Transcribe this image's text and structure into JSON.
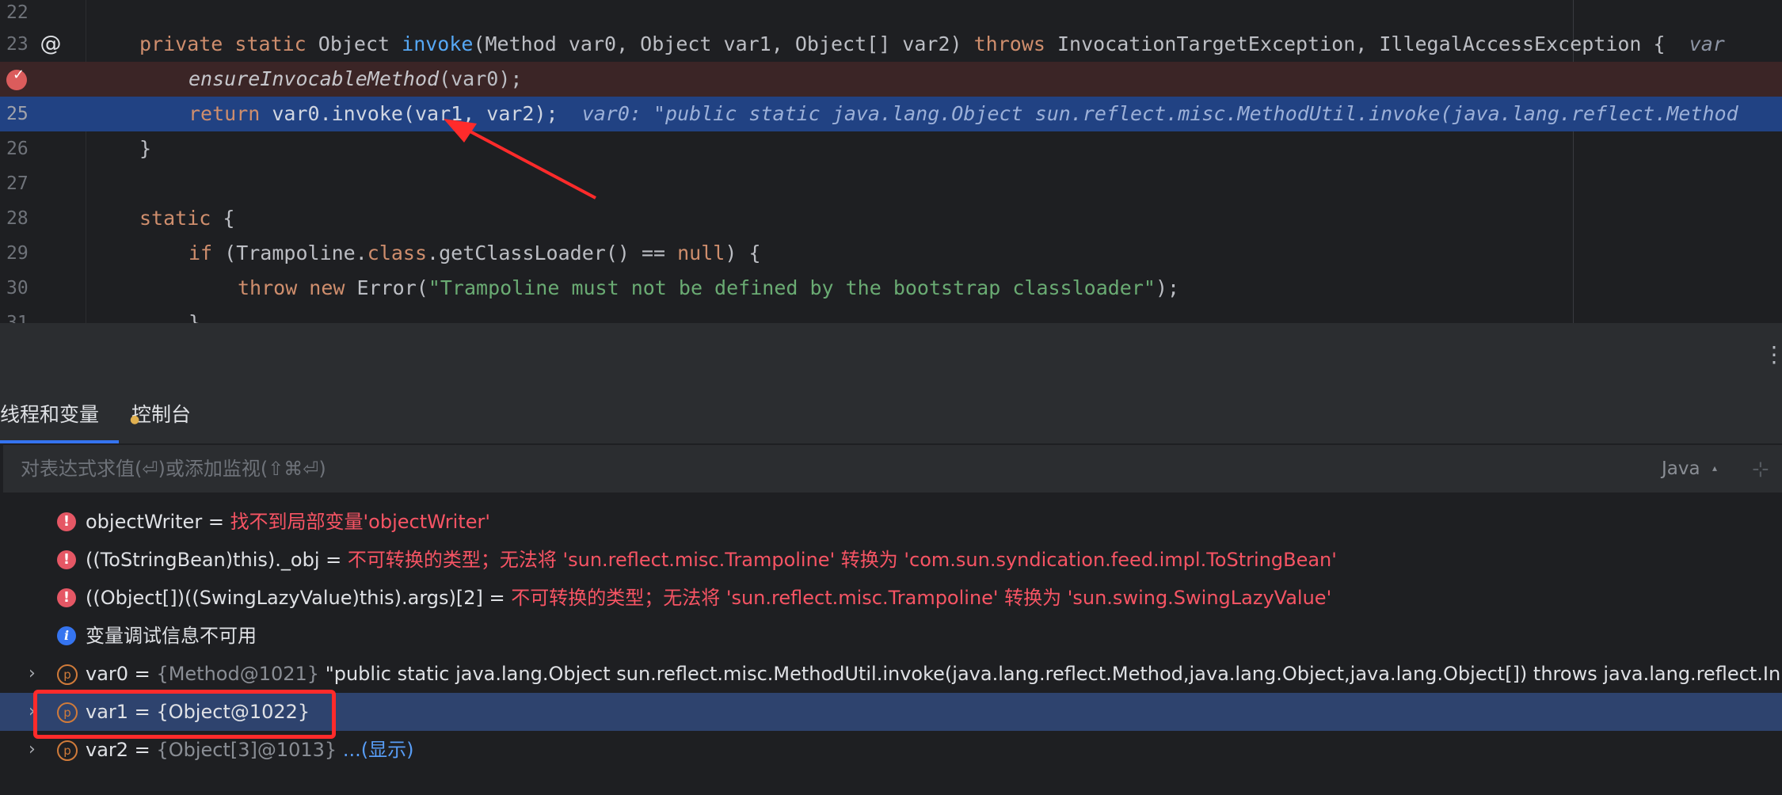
{
  "editor": {
    "lines": [
      {
        "n": "22"
      },
      {
        "n": "23",
        "code_parts": {
          "kw1": "private static ",
          "t1": "Object ",
          "fn": "invoke",
          "t2": "(Method var0, Object var1, Object[] var2) ",
          "kw2": "throws ",
          "t3": "InvocationTargetException, IllegalAccessException {",
          "hint": "var"
        }
      },
      {
        "n": "",
        "call": "ensureInvocableMethod",
        "rest": "(var0);"
      },
      {
        "n": "25",
        "kw": "return ",
        "rest": "var0.invoke(var1, var2);",
        "hint": "var0: \"public static java.lang.Object sun.reflect.misc.MethodUtil.invoke(java.lang.reflect.Method"
      },
      {
        "n": "26",
        "code": "}"
      },
      {
        "n": "27"
      },
      {
        "n": "28",
        "kw": "static ",
        "rest": "{"
      },
      {
        "n": "29",
        "kw": "if ",
        "t1": "(Trampoline.",
        "kw2": "class",
        "t2": ".getClassLoader() == ",
        "kw3": "null",
        "t3": ") {"
      },
      {
        "n": "30",
        "kw": "throw new ",
        "t1": "Error(",
        "str": "\"Trampoline must not be defined by the bootstrap classloader\"",
        "t2": ");"
      },
      {
        "n": "31",
        "code": "}"
      }
    ]
  },
  "panel": {
    "tabs": [
      {
        "label": "线程和变量"
      },
      {
        "label": "控制台"
      }
    ],
    "eval_placeholder": "对表达式求值(⏎)或添加监视(⇧⌘⏎)",
    "language": "Java"
  },
  "variables": [
    {
      "type": "error",
      "name": "objectWriter = ",
      "message": "找不到局部变量'objectWriter'"
    },
    {
      "type": "error",
      "name": "((ToStringBean)this)._obj = ",
      "message": "不可转换的类型；无法将 'sun.reflect.misc.Trampoline' 转换为 'com.sun.syndication.feed.impl.ToStringBean'"
    },
    {
      "type": "error",
      "name": "((Object[])((SwingLazyValue)this).args)[2] = ",
      "message": "不可转换的类型；无法将 'sun.reflect.misc.Trampoline' 转换为 'sun.swing.SwingLazyValue'"
    },
    {
      "type": "info",
      "message": "变量调试信息不可用"
    },
    {
      "type": "param",
      "name": "var0 = ",
      "meta": "{Method@1021} ",
      "value": "\"public static java.lang.Object sun.reflect.misc.MethodUtil.invoke(java.lang.reflect.Method,java.lang.Object,java.lang.Object[]) throws java.lang.reflect.In",
      "more": "...("
    },
    {
      "type": "param",
      "name": "var1 = {Object@1022}"
    },
    {
      "type": "param",
      "name": "var2 = ",
      "meta": "{Object[3]@1013} ",
      "link": "...(显示)"
    }
  ],
  "colors": {
    "accent": "#3574f0",
    "error": "#f75464",
    "annotation": "#ff2b2b"
  }
}
